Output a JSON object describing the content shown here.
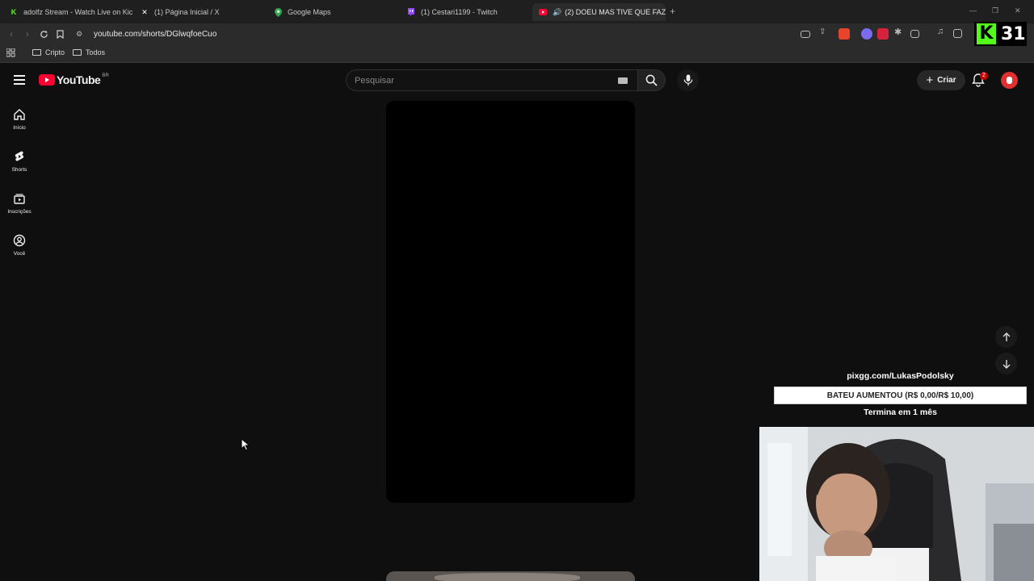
{
  "browser": {
    "tabs": [
      {
        "title": "adolfz Stream - Watch Live on Kick",
        "favicon": "kick-icon",
        "color": "#53fc18",
        "active": false
      },
      {
        "title": "(1) Página Inicial / X",
        "favicon": "x-icon",
        "color": "#ffffff",
        "active": false
      },
      {
        "title": "Google Maps",
        "favicon": "maps-pin-icon",
        "color": "#34a853",
        "active": false
      },
      {
        "title": "(1) Cestari1199 - Twitch",
        "favicon": "twitch-icon",
        "color": "#9146ff",
        "active": false
      },
      {
        "title": "(2) DOEU MAS TIVE QUE FAZ",
        "favicon": "youtube-icon",
        "color": "#ff0033",
        "active": true
      }
    ],
    "url": "youtube.com/shorts/DGlwqfoeCuo",
    "bookmarks": [
      {
        "label": "Cripto"
      },
      {
        "label": "Todos"
      }
    ]
  },
  "youtube": {
    "logo_text": "YouTube",
    "region": "BR",
    "search_placeholder": "Pesquisar",
    "create_label": "Criar",
    "notifications_count": "2",
    "sidebar": [
      {
        "label": "Início",
        "icon": "home-icon"
      },
      {
        "label": "Shorts",
        "icon": "shorts-icon"
      },
      {
        "label": "Inscrições",
        "icon": "subscriptions-icon"
      },
      {
        "label": "Você",
        "icon": "you-icon"
      }
    ]
  },
  "overlay": {
    "link": "pixgg.com/LukasPodolsky",
    "goal": "BATEU AUMENTOU (R$ 0,00/R$ 10,00)",
    "ends": "Termina em 1 mês",
    "kick_badge_number": "31"
  }
}
